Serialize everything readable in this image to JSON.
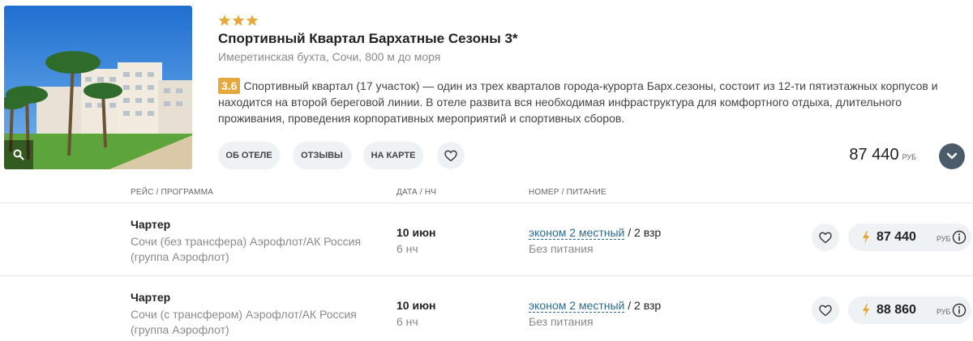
{
  "hotel": {
    "stars": 3,
    "star_color": "#e7a83b",
    "name": "Спортивный Квартал Бархатные Сезоны 3*",
    "location": "Имеретинская бухта, Сочи, 800 м до моря",
    "rating": "3.6",
    "rating_color": "#e7a83b",
    "description": "Спортивный квартал (17 участок) — один из трех кварталов города-курорта Барх.сезоны, состоит из 12-ти пятиэтажных корпусов и находится на второй береговой линии. В отеле развита вся необходимая инфраструктура для комфортного отдыха, длительного проживания, проведения корпоративных мероприятий и спортивных сборов.",
    "photo_icon": "search-icon",
    "buttons": {
      "about": "ОБ ОТЕЛЕ",
      "reviews": "ОТЗЫВЫ",
      "map": "НА КАРТЕ",
      "favorite_icon": "heart-icon"
    },
    "price": "87 440",
    "currency": "РУБ",
    "expand_icon": "chevron-down-icon"
  },
  "table": {
    "headers": {
      "route": "РЕЙС / ПРОГРАММА",
      "date": "ДАТА / НЧ",
      "room": "НОМЕР / ПИТАНИЕ"
    },
    "rows": [
      {
        "type": "Чартер",
        "route": "Сочи (без трансфера) Аэрофлот/АК Россия (группа Аэрофлот)",
        "date": "10 июн",
        "nights": "6 нч",
        "room": "эконом 2 местный",
        "guests": " / 2 взр",
        "meal": "Без питания",
        "price": "87 440",
        "currency": "РУБ"
      },
      {
        "type": "Чартер",
        "route": "Сочи (с трансфером) Аэрофлот/АК Россия (группа Аэрофлот)",
        "date": "10 июн",
        "nights": "6 нч",
        "room": "эконом 2 местный",
        "guests": " / 2 взр",
        "meal": "Без питания",
        "price": "88 860",
        "currency": "РУБ"
      }
    ],
    "accent_color": "#2b6a91",
    "bolt_color": "#f0a030"
  }
}
